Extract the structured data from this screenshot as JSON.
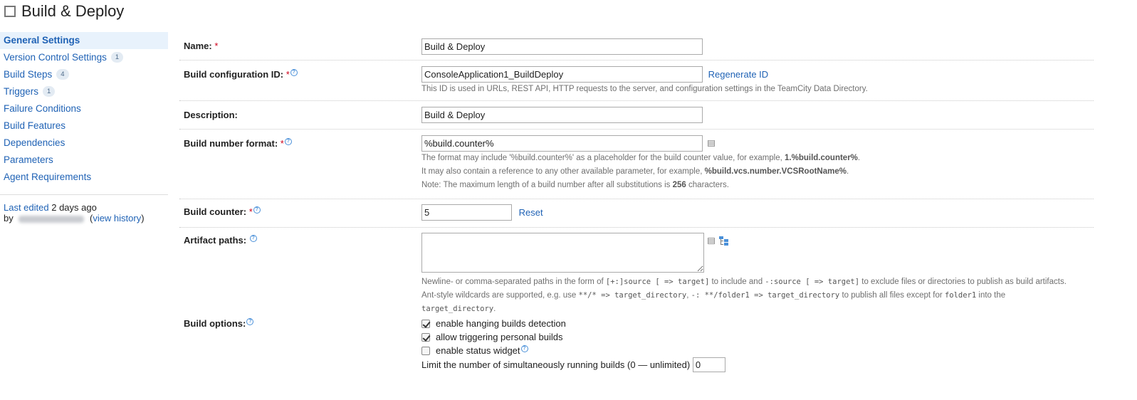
{
  "header": {
    "title": "Build & Deploy"
  },
  "sidebar": {
    "items": [
      {
        "label": "General Settings",
        "count": ""
      },
      {
        "label": "Version Control Settings",
        "count": "1"
      },
      {
        "label": "Build Steps",
        "count": "4"
      },
      {
        "label": "Triggers",
        "count": "1"
      },
      {
        "label": "Failure Conditions",
        "count": ""
      },
      {
        "label": "Build Features",
        "count": ""
      },
      {
        "label": "Dependencies",
        "count": ""
      },
      {
        "label": "Parameters",
        "count": ""
      },
      {
        "label": "Agent Requirements",
        "count": ""
      }
    ],
    "last_edited_label": "Last edited",
    "last_edited_time": "2 days ago",
    "by_label": "by",
    "view_history": "view history"
  },
  "form": {
    "name": {
      "label": "Name:",
      "required": "*",
      "value": "Build & Deploy"
    },
    "config_id": {
      "label": "Build configuration ID:",
      "required": "*",
      "value": "ConsoleApplication1_BuildDeploy",
      "action": "Regenerate ID",
      "note": "This ID is used in URLs, REST API, HTTP requests to the server, and configuration settings in the TeamCity Data Directory."
    },
    "description": {
      "label": "Description:",
      "value": "Build & Deploy"
    },
    "build_number": {
      "label": "Build number format:",
      "required": "*",
      "value": "%build.counter%",
      "note1_pre": "The format may include '%build.counter%' as a placeholder for the build counter value, for example, ",
      "note1_bold": "1.%build.counter%",
      "note1_post": ".",
      "note2_pre": "It may also contain a reference to any other available parameter, for example, ",
      "note2_bold": "%build.vcs.number.VCSRootName%",
      "note2_post": ".",
      "note3_pre": "Note: The maximum length of a build number after all substitutions is ",
      "note3_bold": "256",
      "note3_post": " characters."
    },
    "build_counter": {
      "label": "Build counter:",
      "required": "*",
      "value": "5",
      "action": "Reset"
    },
    "artifact_paths": {
      "label": "Artifact paths:",
      "value": "",
      "n1a": "Newline- or comma-separated paths in the form of ",
      "n1b": "[+:]source [ => target]",
      "n1c": " to include and ",
      "n1d": "-:source [ => target]",
      "n1e": " to exclude files or directories to publish as build artifacts.",
      "n2a": "Ant-style wildcards are supported, e.g. use ",
      "n2b": "**/* => target_directory",
      "n2c": ", ",
      "n2d": "-: **/folder1 => target_directory",
      "n2e": " to publish all files except for ",
      "n2f": "folder1",
      "n2g": " into the",
      "n3a": "target_directory",
      "n3b": "."
    },
    "build_options": {
      "label": "Build options:",
      "opt1": "enable hanging builds detection",
      "opt2": "allow triggering personal builds",
      "opt3": "enable status widget",
      "limit_label": "Limit the number of simultaneously running builds (0 — unlimited)",
      "limit_value": "0"
    }
  }
}
